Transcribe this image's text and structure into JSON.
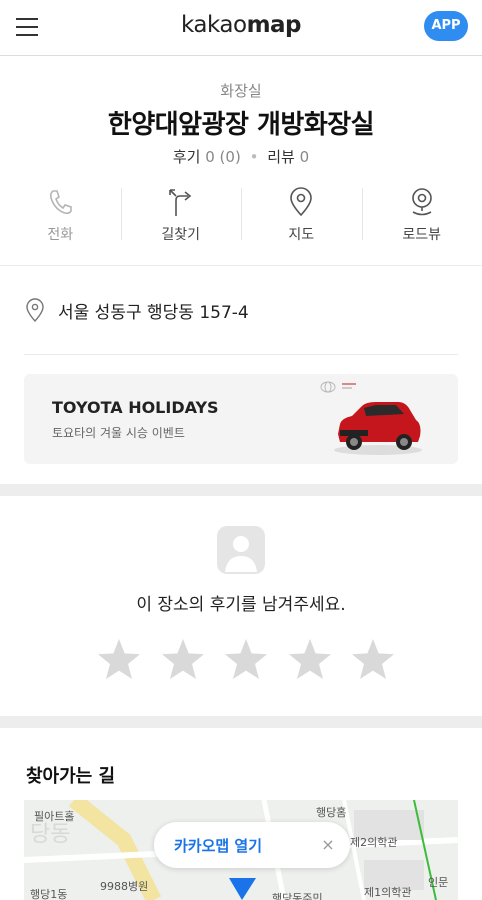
{
  "header": {
    "logo_prefix": "kakao",
    "logo_suffix": "map",
    "app_button": "APP"
  },
  "place": {
    "category": "화장실",
    "name": "한양대앞광장 개방화장실",
    "review_label": "후기",
    "review_count": "0 (0)",
    "rating_label": "리뷰",
    "rating_count": "0"
  },
  "actions": [
    {
      "label": "전화",
      "icon": "phone-icon"
    },
    {
      "label": "길찾기",
      "icon": "directions-icon"
    },
    {
      "label": "지도",
      "icon": "map-pin-icon"
    },
    {
      "label": "로드뷰",
      "icon": "roadview-icon"
    }
  ],
  "address": "서울 성동구 행당동 157-4",
  "ad": {
    "title": "TOYOTA HOLIDAYS",
    "subtitle": "토요타의 겨울 시승 이벤트"
  },
  "review_prompt": {
    "text": "이 장소의 후기를 남겨주세요.",
    "stars": 5
  },
  "route": {
    "title": "찾아가는 길",
    "open_button": "카카오맵 열기",
    "close_symbol": "×",
    "map_labels": [
      "필아트홀",
      "행당홈",
      "제2의학관",
      "9988병원",
      "행당1동",
      "제1의학관",
      "인문",
      "당동",
      "행당동주민"
    ]
  },
  "colors": {
    "accent": "#2f8cf0",
    "map_link": "#1a73e8",
    "star": "#d9d9d9"
  }
}
